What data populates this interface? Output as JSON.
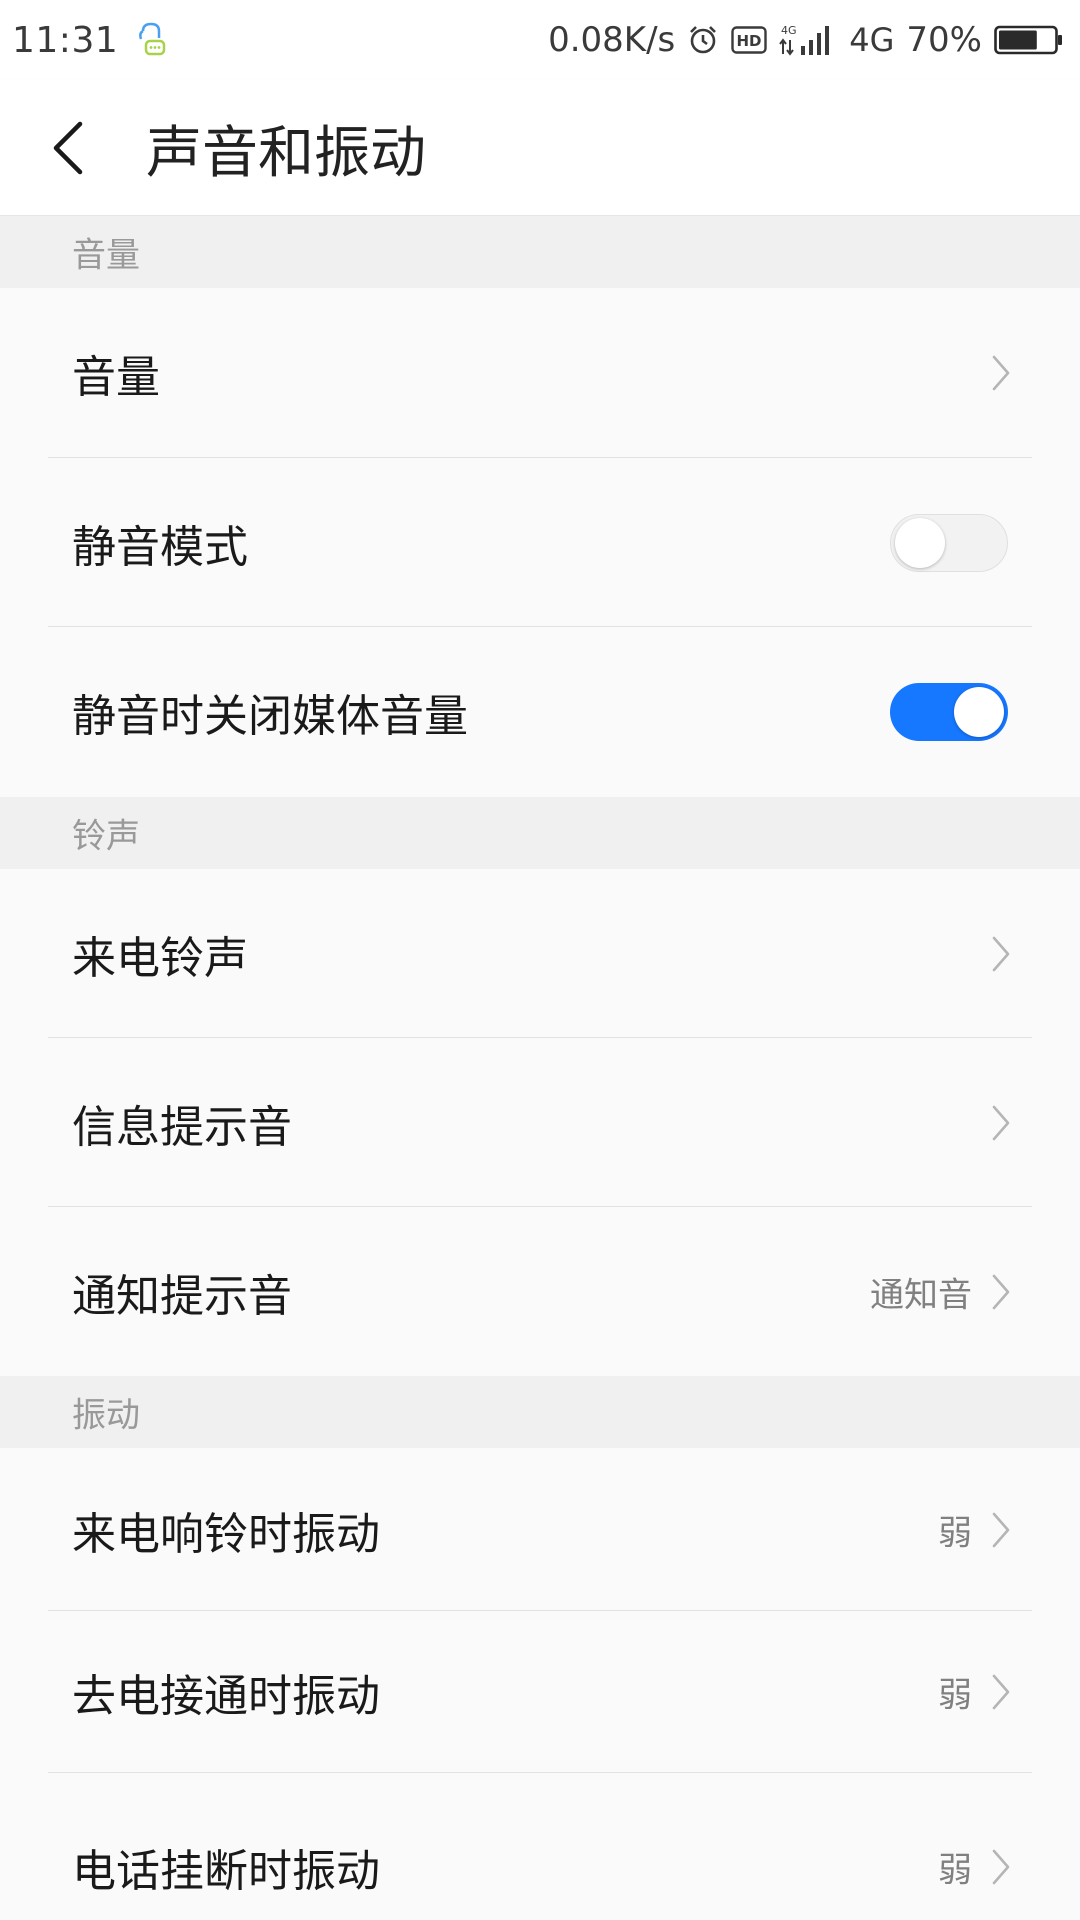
{
  "status_bar": {
    "time": "11:31",
    "net_speed": "0.08K/s",
    "hd_label": "HD",
    "signal_label": "4G",
    "net_type": "4G",
    "battery": "70%",
    "battery_level": 0.7
  },
  "header": {
    "title": "声音和振动"
  },
  "sections": {
    "volume": {
      "header": "音量",
      "items": [
        {
          "label": "音量",
          "type": "nav"
        },
        {
          "label": "静音模式",
          "type": "toggle",
          "on": false
        },
        {
          "label": "静音时关闭媒体音量",
          "type": "toggle",
          "on": true
        }
      ]
    },
    "ringtone": {
      "header": "铃声",
      "items": [
        {
          "label": "来电铃声",
          "type": "nav"
        },
        {
          "label": "信息提示音",
          "type": "nav"
        },
        {
          "label": "通知提示音",
          "type": "nav",
          "value": "通知音"
        }
      ]
    },
    "vibration": {
      "header": "振动",
      "items": [
        {
          "label": "来电响铃时振动",
          "type": "nav",
          "value": "弱"
        },
        {
          "label": "去电接通时振动",
          "type": "nav",
          "value": "弱"
        },
        {
          "label": "电话挂断时振动",
          "type": "nav",
          "value": "弱"
        }
      ]
    }
  },
  "colors": {
    "accent": "#1677ff",
    "section_bg": "#f0f0f0",
    "row_bg": "#fafafa",
    "secondary_text": "#999999"
  },
  "icons": {
    "back": "chevron-left-icon",
    "row_nav": "chevron-right-icon",
    "notification": "chat-bubble-icon",
    "alarm": "alarm-clock-icon",
    "signal": "cell-signal-icon",
    "battery": "battery-icon"
  }
}
